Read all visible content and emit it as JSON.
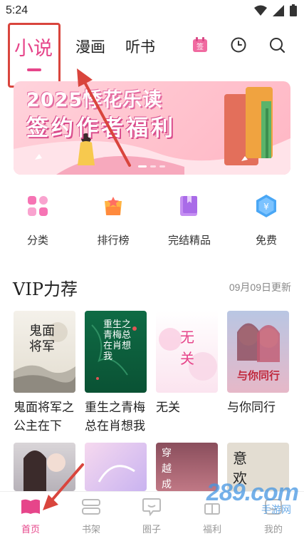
{
  "status": {
    "time": "5:24"
  },
  "tabs": [
    {
      "label": "小说",
      "active": true
    },
    {
      "label": "漫画",
      "active": false
    },
    {
      "label": "听书",
      "active": false
    }
  ],
  "header_icons": [
    "sign-in-icon",
    "history-clock-icon",
    "search-icon"
  ],
  "sign_badge": "签",
  "banner": {
    "line1": "2025悸花乐读",
    "line2": "签约作者福利"
  },
  "categories": [
    {
      "label": "分类",
      "icon": "grid-icon"
    },
    {
      "label": "排行榜",
      "icon": "trophy-icon"
    },
    {
      "label": "完结精品",
      "icon": "book-icon"
    },
    {
      "label": "免费",
      "icon": "yen-hexagon-icon"
    }
  ],
  "section": {
    "title": "VIP力荐",
    "updated": "09月09日更新"
  },
  "books": [
    {
      "title": "鬼面将军之公主在下",
      "cover_text": "鬼面将军"
    },
    {
      "title": "重生之青梅总在肖想我",
      "cover_text": "重生之青梅总在肖想我"
    },
    {
      "title": "无关",
      "cover_text": "无关"
    },
    {
      "title": "与你同行",
      "cover_text": "与你同行"
    }
  ],
  "books_row2": [
    {
      "cover_text": ""
    },
    {
      "cover_text": ""
    },
    {
      "cover_text": "穿越成"
    },
    {
      "cover_text": "意欢"
    }
  ],
  "nav": [
    {
      "label": "首页",
      "active": true
    },
    {
      "label": "书架",
      "active": false
    },
    {
      "label": "圈子",
      "active": false
    },
    {
      "label": "福利",
      "active": false
    },
    {
      "label": "我的",
      "active": false
    }
  ],
  "watermark": {
    "brand": "289.com",
    "sub": "手游网"
  },
  "colors": {
    "accent": "#e6458a",
    "annotation": "#d9453d"
  }
}
